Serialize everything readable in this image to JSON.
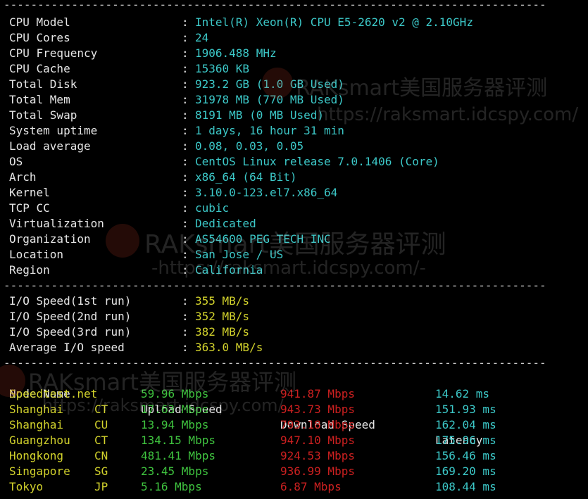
{
  "separator": "--------------------------------------------------------------------------------------------------------",
  "sysinfo": [
    {
      "label": "CPU Model",
      "value": "Intel(R) Xeon(R) CPU E5-2620 v2 @ 2.10GHz"
    },
    {
      "label": "CPU Cores",
      "value": "24"
    },
    {
      "label": "CPU Frequency",
      "value": "1906.488 MHz"
    },
    {
      "label": "CPU Cache",
      "value": "15360 KB"
    },
    {
      "label": "Total Disk",
      "value": "923.2 GB (1.0 GB Used)"
    },
    {
      "label": "Total Mem",
      "value": "31978 MB (770 MB Used)"
    },
    {
      "label": "Total Swap",
      "value": "8191 MB (0 MB Used)"
    },
    {
      "label": "System uptime",
      "value": "1 days, 16 hour 31 min"
    },
    {
      "label": "Load average",
      "value": "0.08, 0.03, 0.05"
    },
    {
      "label": "OS",
      "value": "CentOS Linux release 7.0.1406 (Core)"
    },
    {
      "label": "Arch",
      "value": "x86_64 (64 Bit)"
    },
    {
      "label": "Kernel",
      "value": "3.10.0-123.el7.x86_64"
    },
    {
      "label": "TCP CC",
      "value": "cubic"
    },
    {
      "label": "Virtualization",
      "value": "Dedicated"
    },
    {
      "label": "Organization",
      "value": "AS54600 PEG TECH INC"
    },
    {
      "label": "Location",
      "value": "San Jose / US"
    },
    {
      "label": "Region",
      "value": "California"
    }
  ],
  "io": [
    {
      "label": "I/O Speed(1st run)",
      "value": "355 MB/s"
    },
    {
      "label": "I/O Speed(2nd run)",
      "value": "352 MB/s"
    },
    {
      "label": "I/O Speed(3rd run)",
      "value": "382 MB/s"
    },
    {
      "label": "Average I/O speed",
      "value": "363.0 MB/s"
    }
  ],
  "speed_header": {
    "node": "Node Name",
    "upload": "Upload Speed",
    "download": "Download Speed",
    "latency": "Latency"
  },
  "speed_rows": [
    {
      "node": "Speedtest.net",
      "code": "",
      "upload": "59.96 Mbps",
      "download": "941.87 Mbps",
      "latency": "14.62 ms"
    },
    {
      "node": "Shanghai",
      "code": "CT",
      "upload": "17.63 Mbps",
      "download": "943.73 Mbps",
      "latency": "151.93 ms"
    },
    {
      "node": "Shanghai",
      "code": "CU",
      "upload": "13.94 Mbps",
      "download": "793.18 Mbps",
      "latency": "162.04 ms"
    },
    {
      "node": "Guangzhou",
      "code": "CT",
      "upload": "134.15 Mbps",
      "download": "947.10 Mbps",
      "latency": "175.96 ms"
    },
    {
      "node": "Hongkong",
      "code": "CN",
      "upload": "481.41 Mbps",
      "download": "924.53 Mbps",
      "latency": "156.46 ms"
    },
    {
      "node": "Singapore",
      "code": "SG",
      "upload": "23.45 Mbps",
      "download": "936.99 Mbps",
      "latency": "169.20 ms"
    },
    {
      "node": "Tokyo",
      "code": "JP",
      "upload": "5.16 Mbps",
      "download": "6.87 Mbps",
      "latency": "108.44 ms"
    }
  ],
  "watermark": {
    "brand": "RAKsmart美国服务器评测",
    "url": "https://raksmart.idcspy.com/",
    "url_dashed": "-https://raksmart.idcspy.com/-"
  },
  "colors": {
    "background": "#000000",
    "label": "#e6e6e6",
    "value_cyan": "#3cc8c8",
    "value_yellow": "#d2d22c",
    "upload_green": "#3fc33f",
    "download_red": "#cc2020"
  }
}
